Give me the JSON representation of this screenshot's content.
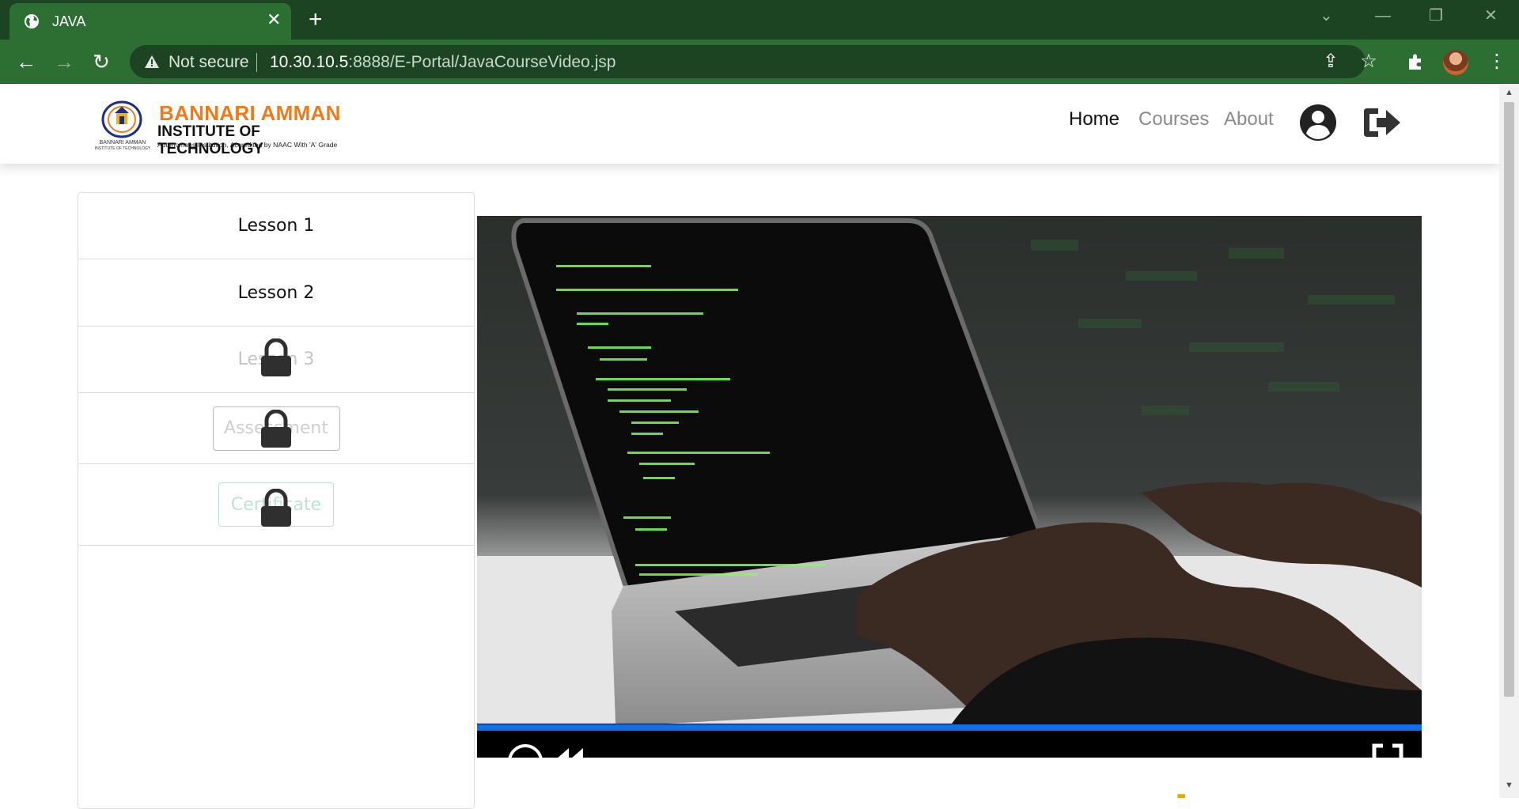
{
  "browser": {
    "tab_title": "JAVA",
    "tab_close": "✕",
    "new_tab": "+",
    "security_label": "Not secure",
    "url_host": "10.30.10.5",
    "url_rest": ":8888/E-Portal/JavaCourseVideo.jsp",
    "icons": [
      "globe-icon",
      "warning-icon",
      "back-icon",
      "forward-icon",
      "reload-icon",
      "share-icon",
      "star-icon",
      "extensions-icon",
      "profile-avatar",
      "menu-icon"
    ]
  },
  "site": {
    "logo": {
      "line1": "BANNARI AMMAN",
      "line2": "INSTITUTE OF TECHNOLOGY",
      "line3": "Autonomous Institution, Accredited by NAAC With 'A' Grade",
      "emblem_line1": "BANNARI AMMAN",
      "emblem_line2": "INSTITUTE OF TECHNOLOGY",
      "emblem_line3": "Stay Ahead"
    },
    "nav": [
      {
        "label": "Home",
        "active": true
      },
      {
        "label": "Courses",
        "active": false
      },
      {
        "label": "About",
        "active": false
      }
    ]
  },
  "sidebar": {
    "lesson1": "Lesson 1",
    "lesson2": "Lesson 2",
    "lesson3": "Lesson 3",
    "assessment": "Assessment",
    "certificate": "Certificate",
    "locked_items": [
      "Lesson 3",
      "Assessment",
      "Certificate"
    ]
  },
  "video": {
    "progress": 1.0
  },
  "colors": {
    "tab_bar": "#1c4423",
    "toolbar": "#2d6f33",
    "logo_orange": "#f07a1a",
    "progress_blue": "#0a6ff0"
  }
}
